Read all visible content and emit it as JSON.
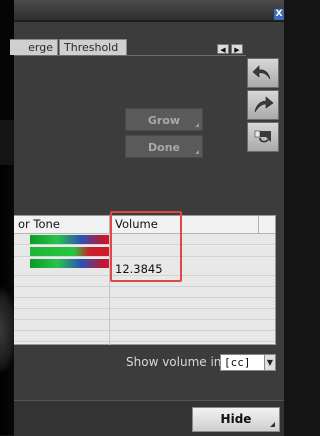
{
  "window": {
    "close_label": "X"
  },
  "tabs": [
    {
      "label": "erge"
    },
    {
      "label": "Threshold"
    }
  ],
  "tab_scroll": {
    "left": "◀",
    "right": "▶"
  },
  "tools": [
    {
      "icon": "undo-arrow-icon"
    },
    {
      "icon": "redo-arrow-icon"
    },
    {
      "icon": "eraser-icon"
    }
  ],
  "actions": {
    "grow_label": "Grow",
    "done_label": "Done"
  },
  "table": {
    "headers": {
      "tone": "or Tone",
      "volume": "Volume"
    },
    "rows": [
      {
        "tone": "rainbow",
        "volume": ""
      },
      {
        "tone": "green-red",
        "volume": ""
      },
      {
        "tone": "rainbow",
        "volume": "12.3845"
      }
    ]
  },
  "show_volume": {
    "label": "Show volume in",
    "unit": "[cc]",
    "arrow": "▼"
  },
  "footer": {
    "hide_label": "Hide"
  },
  "colors": {
    "highlight": "#e04848",
    "accent": "#3b6fb6"
  }
}
